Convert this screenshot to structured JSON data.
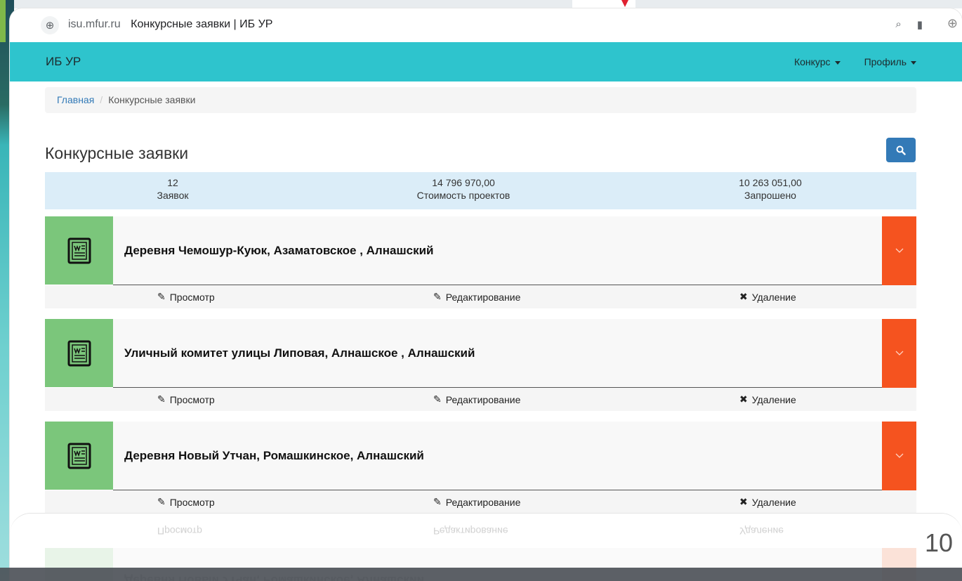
{
  "browser": {
    "host": "isu.mfur.ru",
    "tab_title": "Конкурсные заявки | ИБ УР"
  },
  "navbar": {
    "brand": "ИБ УР",
    "menu": [
      {
        "label": "Конкурс"
      },
      {
        "label": "Профиль"
      }
    ]
  },
  "breadcrumb": {
    "home": "Главная",
    "separator": "/",
    "current": "Конкурсные заявки"
  },
  "page": {
    "title": "Конкурсные заявки"
  },
  "stats": [
    {
      "value": "12",
      "label": "Заявок"
    },
    {
      "value": "14 796 970,00",
      "label": "Стоимость проектов"
    },
    {
      "value": "10 263 051,00",
      "label": "Запрошено"
    }
  ],
  "actions": {
    "view": "Просмотр",
    "edit": "Редактирование",
    "delete": "Удаление"
  },
  "applications": [
    {
      "title": "Деревня Чемошур-Куюк, Азаматовское , Алнашский"
    },
    {
      "title": "Уличный комитет улицы Липовая, Алнашское , Алнашский"
    },
    {
      "title": "Деревня Новый Утчан, Ромашкинское, Алнашский"
    }
  ],
  "slide": {
    "number": "10"
  },
  "colors": {
    "navbar": "#2ec4cd",
    "icon_box": "#7bc67b",
    "toggle": "#f5531f",
    "stats_bg": "#dbedf8",
    "search_button": "#337ab7"
  }
}
